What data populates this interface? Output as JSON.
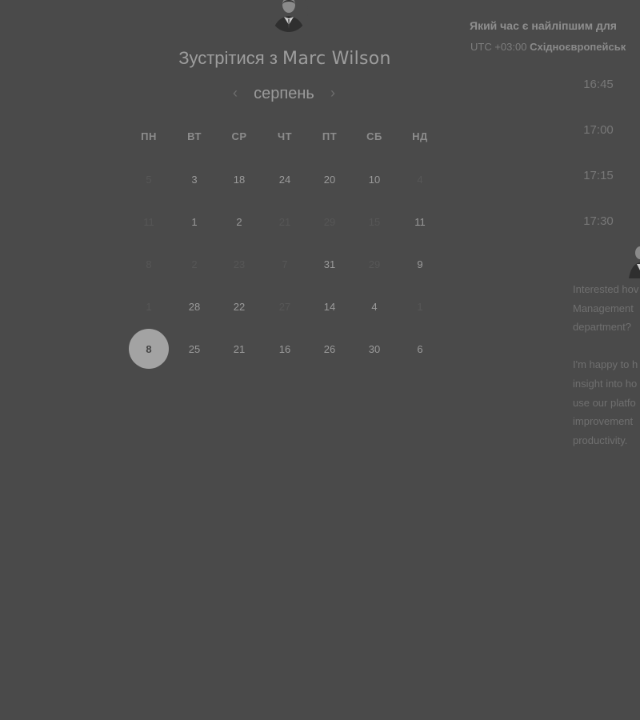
{
  "host": {
    "prefix": "Зустрітися з",
    "name": "Marc Wilson"
  },
  "calendar": {
    "month": "серпень",
    "prev_icon": "chevron-left-icon",
    "next_icon": "chevron-right-icon",
    "weekdays": [
      "ПН",
      "ВТ",
      "СР",
      "ЧТ",
      "ПТ",
      "СБ",
      "НД"
    ],
    "weeks": [
      [
        {
          "n": "5",
          "muted": true
        },
        {
          "n": "3"
        },
        {
          "n": "18"
        },
        {
          "n": "24"
        },
        {
          "n": "20"
        },
        {
          "n": "10"
        },
        {
          "n": "4",
          "muted": true
        }
      ],
      [
        {
          "n": "11",
          "muted": true
        },
        {
          "n": "1"
        },
        {
          "n": "2"
        },
        {
          "n": "21",
          "muted": true
        },
        {
          "n": "29",
          "muted": true
        },
        {
          "n": "15",
          "muted": true
        },
        {
          "n": "11"
        }
      ],
      [
        {
          "n": "8",
          "muted": true
        },
        {
          "n": "2",
          "muted": true
        },
        {
          "n": "23",
          "muted": true
        },
        {
          "n": "7",
          "muted": true
        },
        {
          "n": "31"
        },
        {
          "n": "29",
          "muted": true
        },
        {
          "n": "9"
        }
      ],
      [
        {
          "n": "1",
          "muted": true
        },
        {
          "n": "28"
        },
        {
          "n": "22"
        },
        {
          "n": "27",
          "muted": true
        },
        {
          "n": "14"
        },
        {
          "n": "4"
        },
        {
          "n": "1",
          "muted": true
        }
      ],
      [
        {
          "n": "8",
          "selected": true
        },
        {
          "n": "25"
        },
        {
          "n": "21"
        },
        {
          "n": "16"
        },
        {
          "n": "26"
        },
        {
          "n": "30"
        },
        {
          "n": "6"
        }
      ]
    ]
  },
  "schedule": {
    "heading": "Який час є найліпшим для",
    "timezone_offset": "UTC +03:00",
    "timezone_name": "Східноєвропейськ",
    "slots": [
      "16:45",
      "17:00",
      "17:15",
      "17:30"
    ]
  },
  "description": {
    "paragraphs": [
      [
        "Interested hov",
        "Management",
        "department?"
      ],
      [
        "I'm happy to h",
        "insight into ho",
        "use our platfo",
        "improvement",
        "productivity."
      ]
    ]
  }
}
